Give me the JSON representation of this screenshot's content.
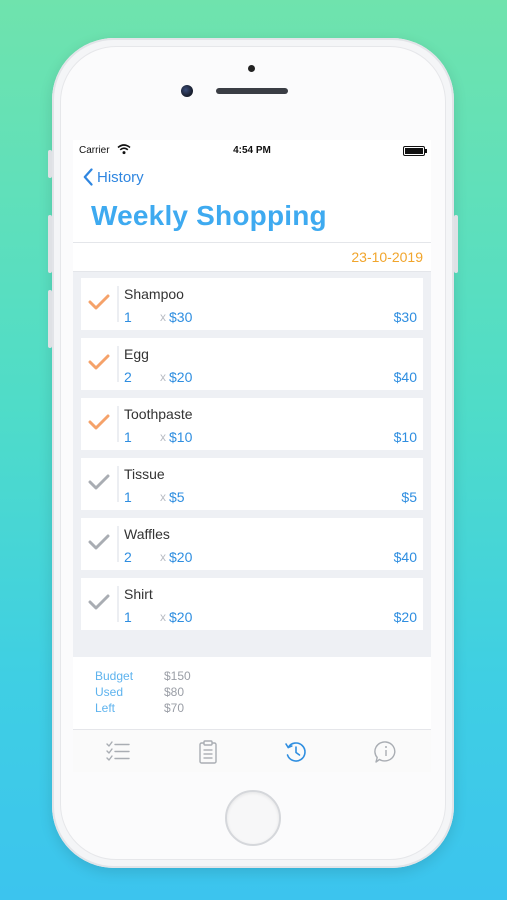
{
  "status_bar": {
    "carrier": "Carrier",
    "time": "4:54 PM"
  },
  "nav": {
    "back_label": "History",
    "title": "Weekly Shopping"
  },
  "date": "23-10-2019",
  "colors": {
    "accent_blue": "#2f8ee0",
    "title_blue": "#3eaaf0",
    "date_orange": "#f1a52c",
    "check_orange": "#f5a26a",
    "check_gray": "#a9adb3"
  },
  "items": [
    {
      "name": "Shampoo",
      "qty": "1",
      "times": "x",
      "price": "$30",
      "total": "$30",
      "checked_color": "orange"
    },
    {
      "name": "Egg",
      "qty": "2",
      "times": "x",
      "price": "$20",
      "total": "$40",
      "checked_color": "orange"
    },
    {
      "name": "Toothpaste",
      "qty": "1",
      "times": "x",
      "price": "$10",
      "total": "$10",
      "checked_color": "orange"
    },
    {
      "name": "Tissue",
      "qty": "1",
      "times": "x",
      "price": "$5",
      "total": "$5",
      "checked_color": "gray"
    },
    {
      "name": "Waffles",
      "qty": "2",
      "times": "x",
      "price": "$20",
      "total": "$40",
      "checked_color": "gray"
    },
    {
      "name": "Shirt",
      "qty": "1",
      "times": "x",
      "price": "$20",
      "total": "$20",
      "checked_color": "gray"
    }
  ],
  "summary": {
    "budget_label": "Budget",
    "budget_value": "$150",
    "used_label": "Used",
    "used_value": "$80",
    "left_label": "Left",
    "left_value": "$70"
  },
  "tabs": [
    {
      "icon": "checklist-icon",
      "active": false
    },
    {
      "icon": "clipboard-icon",
      "active": false
    },
    {
      "icon": "history-icon",
      "active": true
    },
    {
      "icon": "info-bubble-icon",
      "active": false
    }
  ]
}
